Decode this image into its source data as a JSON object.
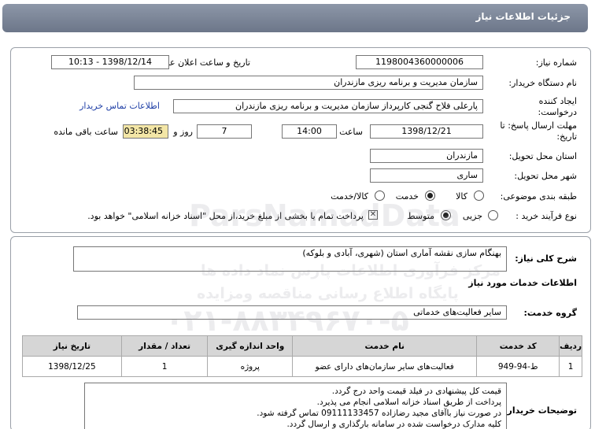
{
  "header": {
    "title": "جزئیات اطلاعات نیاز"
  },
  "fields": {
    "need_number_label": "شماره نیاز:",
    "need_number": "1198004360000006",
    "announce_label": "تاریخ و ساعت اعلان عمومی:",
    "announce_value": "1398/12/14 - 10:13",
    "buyer_label": "نام دستگاه خریدار:",
    "buyer_value": "سازمان مدیریت و برنامه ریزی مازندران",
    "creator_label": "ایجاد کننده درخواست:",
    "creator_value": "پارعلی فلاح گنجی کارپرداز سازمان مدیریت و برنامه ریزی مازندران",
    "contact_link": "اطلاعات تماس خریدار",
    "deadline_label": "مهلت ارسال پاسخ: تا تاریخ:",
    "deadline_date": "1398/12/21",
    "time_label": "ساعت",
    "deadline_time": "14:00",
    "days_value": "7",
    "days_label": "روز و",
    "remaining_time": "03:38:45",
    "remaining_label": "ساعت باقی مانده",
    "province_label": "استان محل تحویل:",
    "province_value": "مازندران",
    "city_label": "شهر محل تحویل:",
    "city_value": "ساری",
    "category_label": "طبقه بندی موضوعی:",
    "category_options": [
      "کالا",
      "خدمت",
      "کالا/خدمت"
    ],
    "category_selected": "خدمت",
    "process_label": "نوع فرآیند خرید :",
    "process_options": [
      "جزیی",
      "متوسط"
    ],
    "process_selected": "متوسط",
    "payment_note": "پرداخت تمام یا بخشی از مبلغ خرید،از محل \"اسناد خزانه اسلامی\" خواهد بود."
  },
  "general_desc": {
    "label": "شرح کلی نیاز:",
    "value": "بهنگام سازی نقشه آماری استان (شهری، آبادی و بلوکه)"
  },
  "services": {
    "section_title": "اطلاعات خدمات مورد نیاز",
    "group_label": "گروه خدمت:",
    "group_value": "سایر فعالیت‌های خدماتی",
    "columns": [
      "ردیف",
      "کد خدمت",
      "نام خدمت",
      "واحد اندازه گیری",
      "تعداد / مقدار",
      "تاریخ نیاز"
    ],
    "rows": [
      [
        "1",
        "ط-94-949",
        "فعالیت‌های سایر سازمان‌های دارای عضو",
        "پروژه",
        "1",
        "1398/12/25"
      ]
    ]
  },
  "buyer_notes": {
    "label": "توضیحات خریدار:",
    "lines": [
      "قیمت کل پیشنهادی در فیلد قیمت واحد درج گردد.",
      "پرداخت از طریق اسناد خزانه اسلامی انجام می پذیرد.",
      "در صورت نیاز باآقای مجید رضازاده  09111133457 تماس گرفته شود.",
      "کلیه مدارک درخواست شده در سامانه بارگذاری و ارسال گردد."
    ]
  },
  "watermark": {
    "brand": "ParsNamadData",
    "fa1": "مرکز فرآوری اطلاعات پارس نماد داده ها",
    "fa2": "پایگاه اطلاع رسانی مناقصه ومزایده",
    "phone": "۰۲۱-۸۸۳۴۹۶۷۰-۵"
  }
}
